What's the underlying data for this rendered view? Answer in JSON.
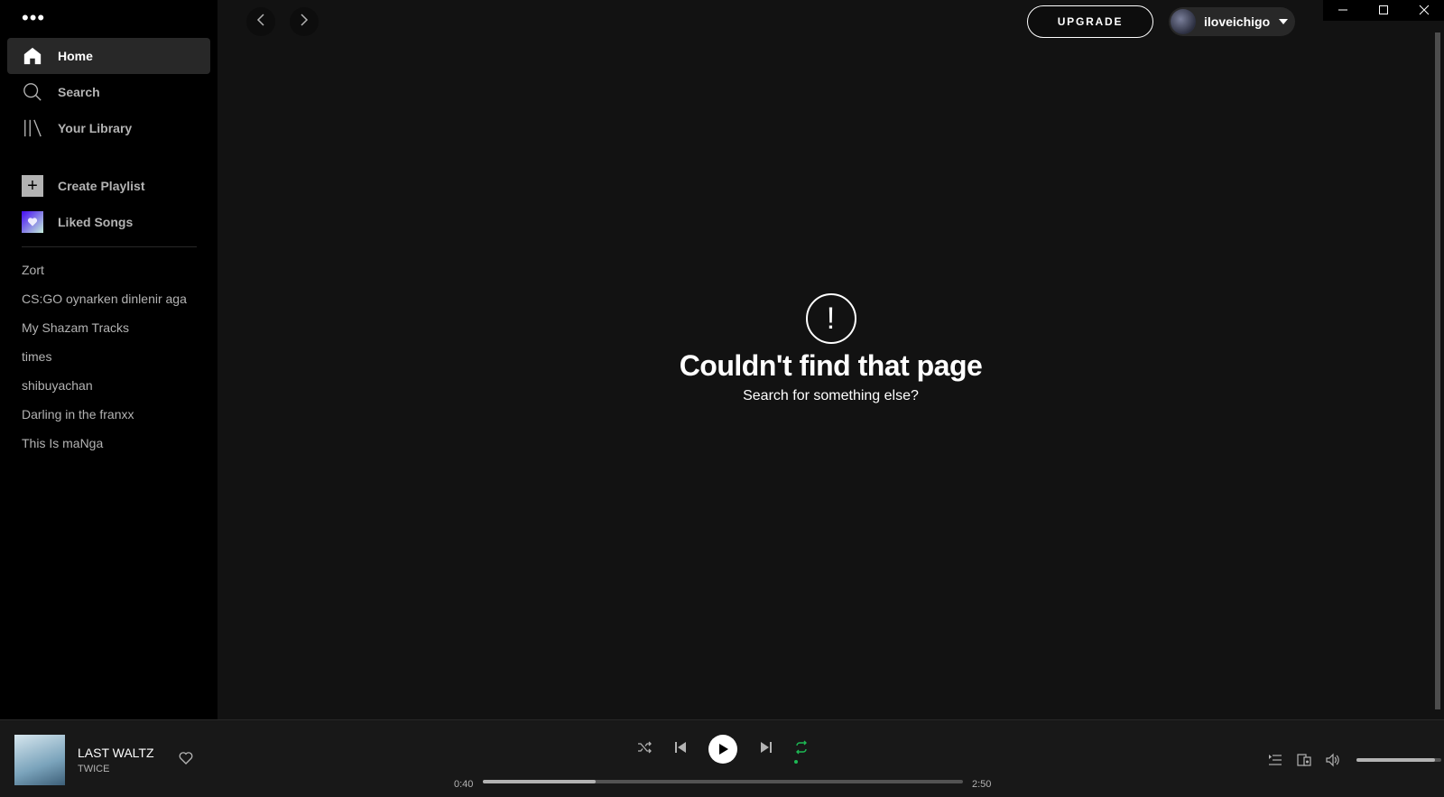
{
  "sidebar": {
    "menu_label": "•••",
    "nav": [
      {
        "label": "Home",
        "icon": "home-icon",
        "active": true
      },
      {
        "label": "Search",
        "icon": "search-icon",
        "active": false
      },
      {
        "label": "Your Library",
        "icon": "library-icon",
        "active": false
      }
    ],
    "actions": [
      {
        "label": "Create Playlist",
        "icon": "plus-icon"
      },
      {
        "label": "Liked Songs",
        "icon": "heart-icon"
      }
    ],
    "playlists": [
      "Zort",
      "CS:GO oynarken dinlenir aga",
      "My Shazam Tracks",
      "times",
      "shibuyachan",
      "Darling in the franxx",
      "This Is maNga"
    ]
  },
  "header": {
    "upgrade_label": "UPGRADE",
    "username": "iloveichigo"
  },
  "error": {
    "symbol": "!",
    "title": "Couldn't find that page",
    "subtitle": "Search for something else?"
  },
  "player": {
    "track": "LAST WALTZ",
    "artist": "TWICE",
    "elapsed": "0:40",
    "duration": "2:50",
    "progress_fraction": 0.235,
    "volume_fraction": 0.93,
    "repeat_active_color": "#1db954"
  },
  "colors": {
    "background": "#121212",
    "sidebar": "#000000",
    "accent": "#1db954"
  }
}
